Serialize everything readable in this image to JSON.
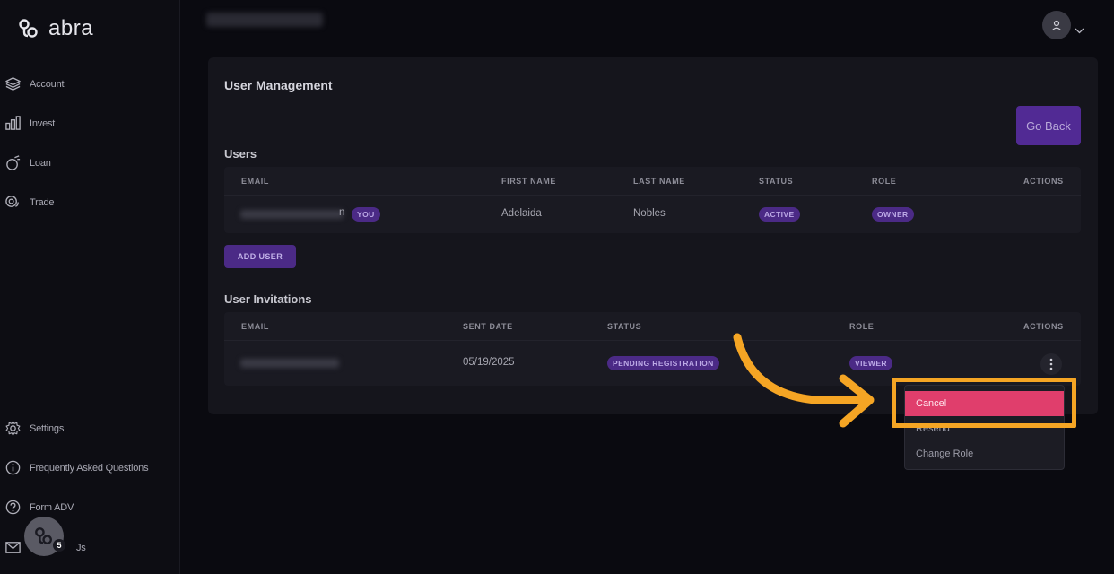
{
  "brand": {
    "name": "abra"
  },
  "sidebar": {
    "items": [
      {
        "label": "Account",
        "icon": "layers-icon"
      },
      {
        "label": "Invest",
        "icon": "bar-chart-icon"
      },
      {
        "label": "Loan",
        "icon": "coin-loan-icon"
      },
      {
        "label": "Trade",
        "icon": "trade-coins-icon"
      }
    ],
    "bottom_items": [
      {
        "label": "Settings",
        "icon": "gear-icon"
      },
      {
        "label": "Frequently Asked Questions",
        "icon": "info-icon"
      },
      {
        "label": "Form ADV",
        "icon": "question-icon"
      },
      {
        "label": "Js",
        "icon": "mail-icon"
      }
    ]
  },
  "chat": {
    "badge": "5"
  },
  "page": {
    "title": "User Management",
    "go_back": "Go Back"
  },
  "users": {
    "label": "Users",
    "columns": [
      "EMAIL",
      "FIRST NAME",
      "LAST NAME",
      "STATUS",
      "ROLE",
      "ACTIONS"
    ],
    "rows": [
      {
        "email_suffix": "n",
        "you_badge": "YOU",
        "first_name": "Adelaida",
        "last_name": "Nobles",
        "status": "ACTIVE",
        "role": "OWNER"
      }
    ],
    "add_user": "ADD USER"
  },
  "invitations": {
    "label": "User Invitations",
    "columns": [
      "EMAIL",
      "SENT DATE",
      "STATUS",
      "ROLE",
      "ACTIONS"
    ],
    "rows": [
      {
        "sent_date": "05/19/2025",
        "status": "PENDING REGISTRATION",
        "role": "VIEWER"
      }
    ]
  },
  "action_menu": {
    "items": [
      "Cancel",
      "Resend",
      "Change Role"
    ]
  },
  "colors": {
    "accent_purple": "#512a94",
    "cancel_pink": "#e03e6c",
    "highlight_orange": "#f5a524"
  }
}
